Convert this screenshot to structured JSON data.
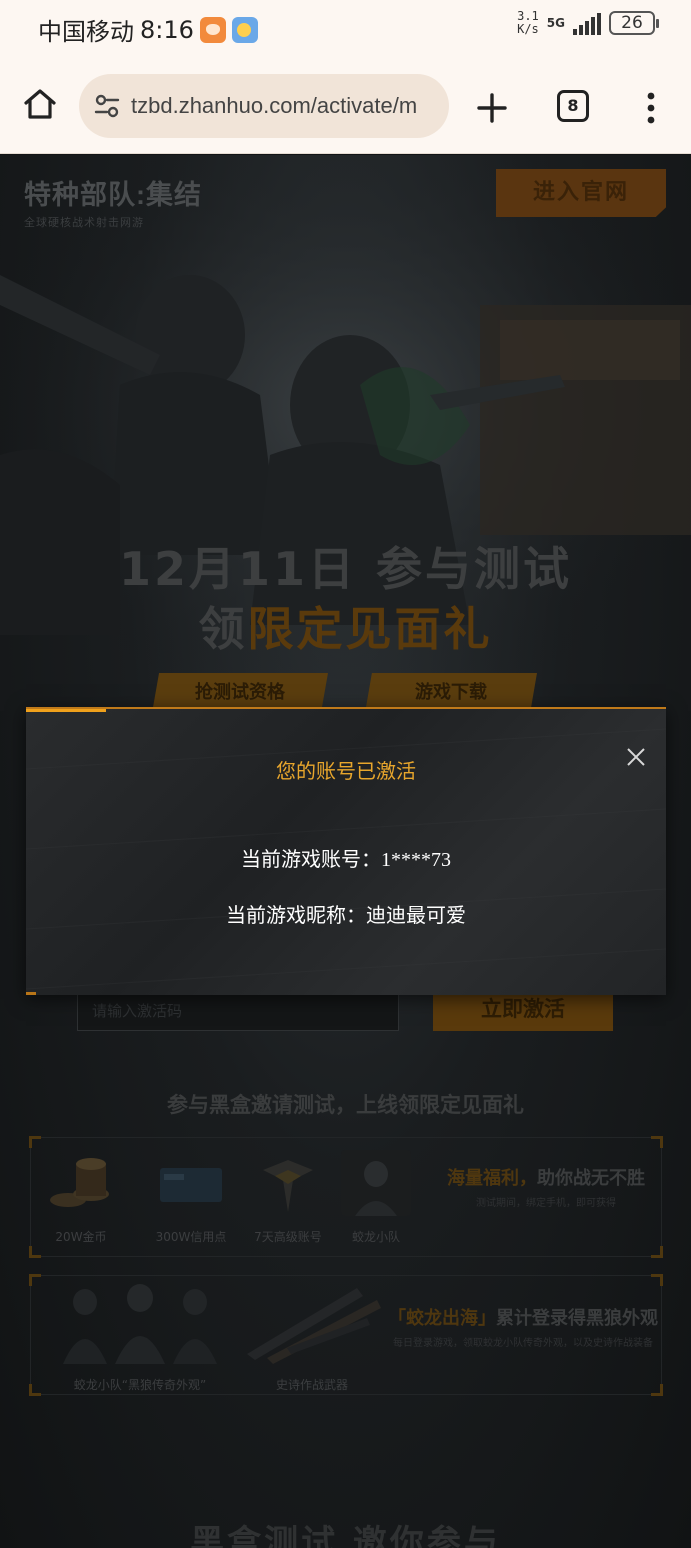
{
  "status_bar": {
    "carrier": "中国移动",
    "time": "8:16",
    "speed_top": "3.1",
    "speed_bottom": "K/s",
    "network": "5G",
    "battery": "26"
  },
  "browser": {
    "url": "tzbd.zhanhuo.com/activate/m",
    "tab_count": "8"
  },
  "page": {
    "logo_title": "特种部队:集结",
    "logo_subtitle": "全球硬核战术射击网游",
    "enter_site": "进入官网",
    "headline_line1": "12月11日 参与测试",
    "headline_line2_part1": "领",
    "headline_line2_part2": "限定见面礼",
    "btn_grab_qualification": "抢测试资格",
    "btn_game_download": "游戏下载",
    "code_input_placeholder": "请输入激活码",
    "activate_now": "立即激活",
    "invite_title": "参与黑盒邀请测试，上线领限定见面礼",
    "rewards": [
      {
        "label": "20W金币",
        "icon": "coins-icon"
      },
      {
        "label": "300W信用点",
        "icon": "credit-card-icon"
      },
      {
        "label": "7天高级账号",
        "icon": "wings-badge-icon"
      },
      {
        "label": "蛟龙小队",
        "icon": "soldier-icon"
      }
    ],
    "promo1_title_gold": "海量福利，",
    "promo1_title_rest": "助你战无不胜",
    "promo1_sub": "测试期间，绑定手机，即可获得",
    "rewards2": [
      {
        "label": "蛟龙小队“黑狼传奇外观”",
        "icon": "squad-icon"
      },
      {
        "label": "史诗作战武器",
        "icon": "weapons-icon"
      }
    ],
    "promo2_title_gold": "「蛟龙出海」",
    "promo2_title_rest": "累计登录得黑狼外观",
    "promo2_sub": "每日登录游戏，领取蛟龙小队传奇外观，以及史诗作战装备",
    "bottom_title": "黑盒测试 邀你参与"
  },
  "modal": {
    "title": "您的账号已激活",
    "account_label": "当前游戏账号：",
    "account_value": "1****73",
    "nickname_label": "当前游戏昵称：",
    "nickname_value": "迪迪最可爱"
  },
  "colors": {
    "accent_gold": "#e8a62c",
    "modal_border": "#c07a1a",
    "browser_bg": "#fdf7f2"
  }
}
